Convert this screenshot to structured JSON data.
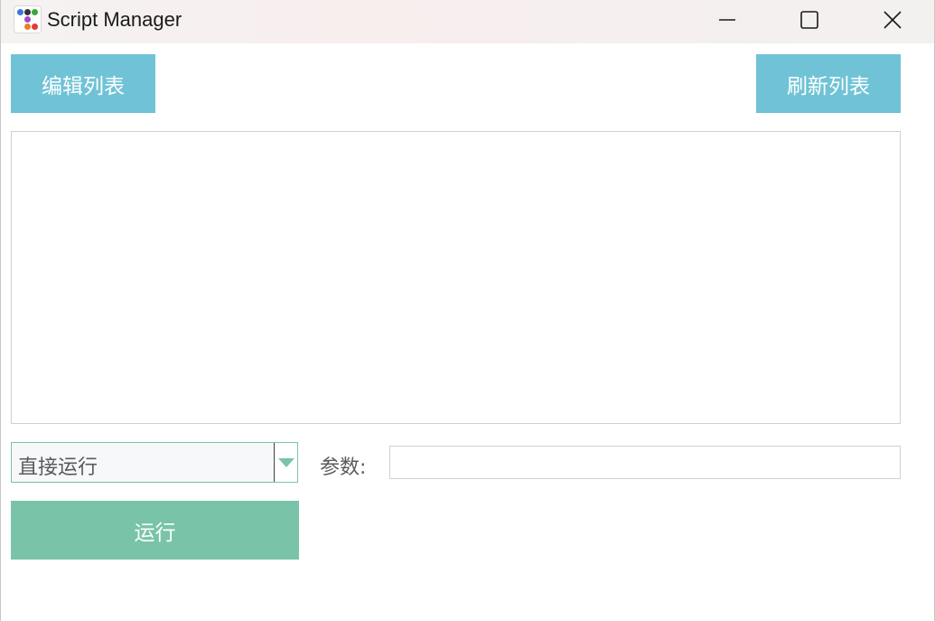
{
  "window": {
    "title": "Script Manager"
  },
  "toolbar": {
    "edit_label": "编辑列表",
    "refresh_label": "刷新列表"
  },
  "script_list": {
    "items": []
  },
  "controls": {
    "mode_selected": "直接运行",
    "param_label": "参数:",
    "param_value": "",
    "run_label": "运行"
  },
  "icons": {
    "app": "app-logo-icon",
    "minimize": "minimize-icon",
    "maximize": "maximize-icon",
    "close": "close-icon",
    "dropdown": "triangle-down-icon"
  },
  "colors": {
    "accent_blue": "#70c3d6",
    "accent_green": "#79c4a9",
    "logo_dots": [
      "#3a78d6",
      "#333333",
      "#3aa63a",
      "#9b4fc4",
      "#f07d2a",
      "#e23a3a"
    ]
  }
}
